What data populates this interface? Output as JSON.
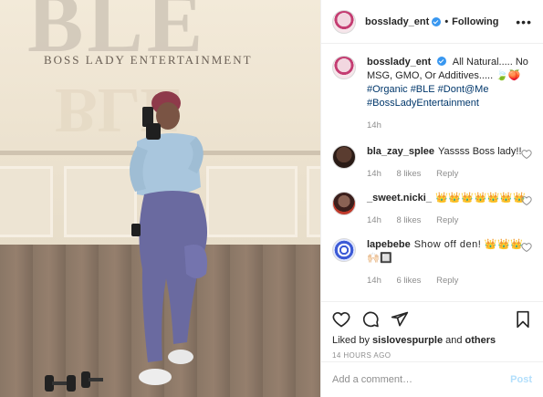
{
  "photo": {
    "sign_text": "BOSS LADY ENTERTAINMENT",
    "logo_letters": "BLE"
  },
  "header": {
    "username": "bosslady_ent",
    "separator": "•",
    "follow_state": "Following",
    "more": "•••"
  },
  "caption": {
    "username": "bosslady_ent",
    "text": "All Natural..... No MSG, GMO, Or Additives..... 🍃🍑",
    "tags": "#Organic #BLE #Dont@Me #BossLadyEntertainment",
    "time": "14h"
  },
  "comments": [
    {
      "username": "bla_zay_splee",
      "text": "Yassss Boss lady!!",
      "time": "14h",
      "likes": "8 likes",
      "reply": "Reply"
    },
    {
      "username": "_sweet.nicki_",
      "text": "👑👑👑👑👑👑👑",
      "time": "14h",
      "likes": "8 likes",
      "reply": "Reply"
    },
    {
      "username": "lapebebe",
      "text": "Show off den! 👑👑👑🙌🏻🔲",
      "time": "14h",
      "likes": "6 likes",
      "reply": "Reply"
    }
  ],
  "engagement": {
    "liked_by_prefix": "Liked by ",
    "liked_by_user": "sislovespurple",
    "liked_by_suffix": " and ",
    "liked_by_others": "others",
    "timestamp": "14 HOURS AGO"
  },
  "add_comment": {
    "placeholder": "Add a comment…",
    "post_label": "Post"
  },
  "icons": [
    "heart-icon",
    "comment-icon",
    "share-icon",
    "save-icon",
    "verified-icon",
    "more-icon"
  ],
  "colors": {
    "link": "#00376b",
    "verified": "#3897f0",
    "post_disabled": "#b2dffc",
    "muted": "#8e8e8e"
  }
}
